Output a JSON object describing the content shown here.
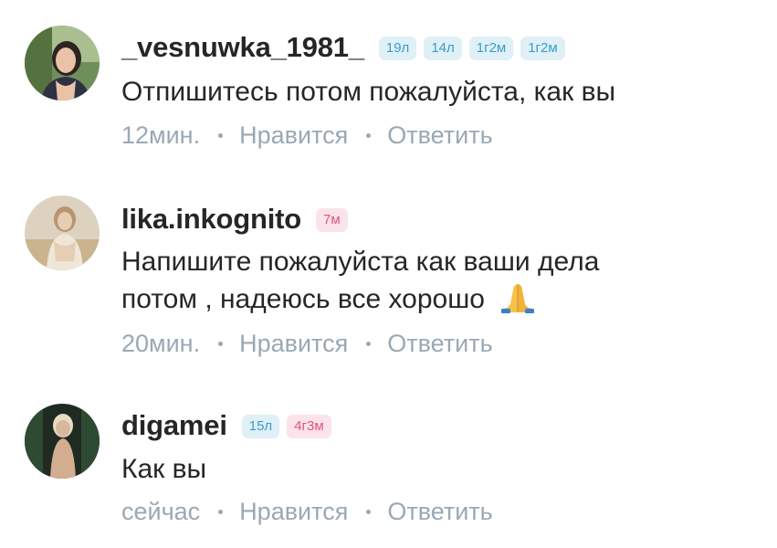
{
  "comments": [
    {
      "username": "_vesnuwka_1981_",
      "badges": [
        {
          "label": "19л",
          "color": "blue"
        },
        {
          "label": "14л",
          "color": "blue"
        },
        {
          "label": "1г2м",
          "color": "blue"
        },
        {
          "label": "1г2м",
          "color": "blue"
        }
      ],
      "text_lines": [
        "Отпишитесь потом пожалуйста, как вы"
      ],
      "time": "12мин.",
      "like_label": "Нравится",
      "reply_label": "Ответить"
    },
    {
      "username": "lika.inkognito",
      "badges": [
        {
          "label": "7м",
          "color": "pink"
        }
      ],
      "text_lines": [
        "Напишите пожалуйста как ваши дела",
        "потом , надеюсь все хорошо"
      ],
      "emoji": "folded-hands-icon",
      "time": "20мин.",
      "like_label": "Нравится",
      "reply_label": "Ответить"
    },
    {
      "username": "digamei",
      "badges": [
        {
          "label": "15л",
          "color": "blue"
        },
        {
          "label": "4г3м",
          "color": "pink"
        }
      ],
      "text_lines": [
        "Как вы"
      ],
      "time": "сейчас",
      "like_label": "Нравится",
      "reply_label": "Ответить"
    }
  ],
  "colors": {
    "text": "#262626",
    "meta": "#9aa8b5",
    "badge_blue_bg": "#dff0f7",
    "badge_blue_text": "#3c9cc8",
    "badge_pink_bg": "#fbe3ea",
    "badge_pink_text": "#e0557f"
  }
}
